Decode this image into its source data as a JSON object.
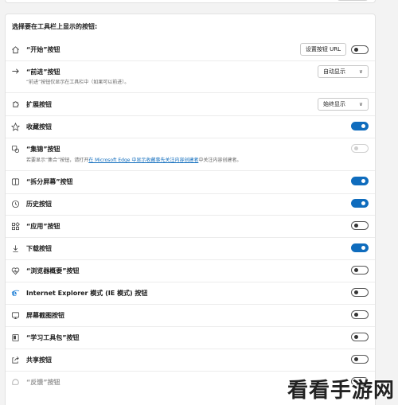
{
  "section_title": "选择要在工具栏上显示的按钮:",
  "rows": [
    {
      "icon": "home-icon",
      "label": "“开始”按钮",
      "control": "button-toggle",
      "button_label": "设置按钮 URL",
      "toggle": "off"
    },
    {
      "icon": "forward-arrow-icon",
      "label": "“前进”按钮",
      "desc": "“前进”按钮仅显示在工具栏中（如果可以前进）。",
      "control": "select",
      "select_value": "自动显示"
    },
    {
      "icon": "puzzle-icon",
      "label": "扩展按钮",
      "control": "select",
      "select_value": "始终显示"
    },
    {
      "icon": "favorites-star-icon",
      "label": "收藏按钮",
      "control": "toggle",
      "toggle": "on"
    },
    {
      "icon": "collections-icon",
      "label": "“集锦”按钮",
      "desc_prefix": "若要显示“集合”按钮，请打开",
      "desc_link": "在 Microsoft Edge 中显示收藏事先关注内容创建者",
      "desc_suffix": "中关注内容创建者。",
      "control": "toggle",
      "toggle": "disabled"
    },
    {
      "icon": "split-screen-icon",
      "label": "“拆分屏幕”按钮",
      "control": "toggle",
      "toggle": "on"
    },
    {
      "icon": "history-icon",
      "label": "历史按钮",
      "control": "toggle",
      "toggle": "on"
    },
    {
      "icon": "apps-icon",
      "label": "“应用”按钮",
      "control": "toggle",
      "toggle": "off"
    },
    {
      "icon": "download-icon",
      "label": "下载按钮",
      "control": "toggle",
      "toggle": "on"
    },
    {
      "icon": "browser-essentials-icon",
      "label": "“浏览器概要”按钮",
      "control": "toggle",
      "toggle": "off"
    },
    {
      "icon": "internet-explorer-icon",
      "label": "Internet Explorer 模式 (IE 模式) 按钮",
      "control": "toggle",
      "toggle": "off"
    },
    {
      "icon": "screenshot-icon",
      "label": "屏幕截图按钮",
      "control": "toggle",
      "toggle": "off"
    },
    {
      "icon": "learning-toolkit-icon",
      "label": "“学习工具包”按钮",
      "control": "toggle",
      "toggle": "off"
    },
    {
      "icon": "share-icon",
      "label": "共享按钮",
      "control": "toggle",
      "toggle": "off"
    },
    {
      "icon": "feedback-icon",
      "label": "“反馈”按钮",
      "control": "toggle",
      "toggle": "off",
      "disabled": true
    }
  ],
  "watermark": "看看手游网",
  "colors": {
    "accent": "#0f6cbd",
    "background": "#f3f3f3",
    "card": "#ffffff"
  }
}
